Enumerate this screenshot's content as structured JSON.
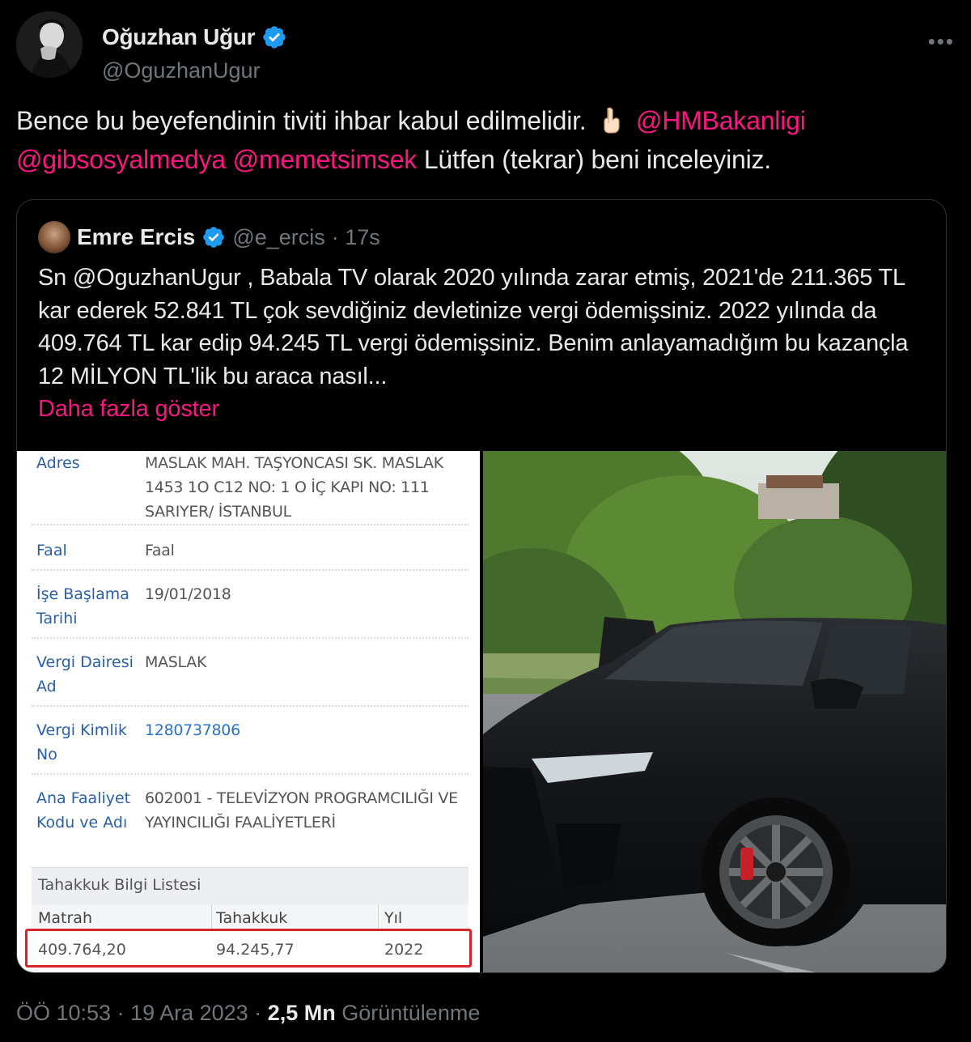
{
  "author": {
    "name": "Oğuzhan Uğur",
    "handle": "@OguzhanUgur"
  },
  "tweet": {
    "text_1": "Bence bu beyefendinin tiviti ihbar kabul edilmelidir.",
    "mention_1": "@HMBakanligi",
    "mention_2": "@gibsosyalmedya",
    "mention_3": "@memetsimsek",
    "text_2": "Lütfen (tekrar) beni inceleyiniz."
  },
  "quote": {
    "name": "Emre Ercis",
    "handle": "@e_ercis",
    "time": "· 17s",
    "text": "Sn @OguzhanUgur , Babala TV olarak 2020 yılında zarar etmiş, 2021'de 211.365 TL kar ederek 52.841 TL çok sevdiğiniz devletinize vergi ödemişsiniz. 2022 yılında da 409.764 TL kar edip 94.245 TL vergi ödemişsiniz. Benim anlayamadığım bu kazançla 12 MİLYON TL'lik bu araca nasıl...",
    "show_more": "Daha fazla göster"
  },
  "document": {
    "rows": [
      {
        "label": "Adres",
        "value": "MASLAK MAH. TAŞYONCASI SK. MASLAK 1453 1O C12 NO: 1 O İÇ KAPI NO: 111 SARIYER/ İSTANBUL"
      },
      {
        "label": "Faal",
        "value": "Faal"
      },
      {
        "label": "İşe Başlama Tarihi",
        "value": "19/01/2018"
      },
      {
        "label": "Vergi Dairesi Ad",
        "value": "MASLAK"
      },
      {
        "label": "Vergi Kimlik No",
        "value": "1280737806"
      },
      {
        "label": "Ana Faaliyet Kodu ve Adı",
        "value": "602001 - TELEVİZYON PROGRAMCILIĞI VE YAYINCILIĞI FAALİYETLERİ"
      }
    ],
    "tahakkuk_title": "Tahakkuk Bilgi Listesi",
    "table": {
      "headers": [
        "Matrah",
        "Tahakkuk",
        "Yıl"
      ],
      "row": [
        "409.764,20",
        "94.245,77",
        "2022"
      ]
    }
  },
  "footer": {
    "time": "ÖÖ 10:53 · 19 Ara 2023 ·",
    "views": "2,5 Mn",
    "views_label": "Görüntülenme"
  },
  "colors": {
    "background": "#000000",
    "text": "#e7e9ea",
    "muted": "#71767b",
    "accent": "#f91880",
    "verified": "#1d9bf0",
    "doc_label": "#2a5fa8",
    "highlight_box": "#d6262b"
  },
  "icons": {
    "verified": "verified-badge-icon",
    "more": "more-options-icon",
    "pointing_down": "backhand-index-pointing-down-emoji"
  }
}
